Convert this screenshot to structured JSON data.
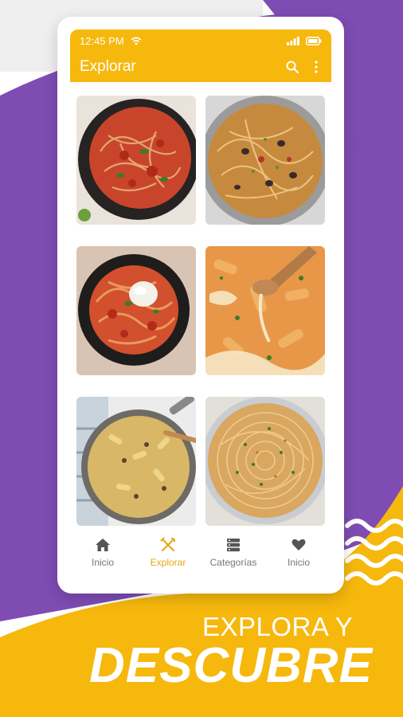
{
  "status_bar": {
    "time": "12:45 PM"
  },
  "app_bar": {
    "title": "Explorar"
  },
  "recipes": [
    {
      "icon": "spaghetti-tomato-basil-image"
    },
    {
      "icon": "spaghetti-olives-pan-image"
    },
    {
      "icon": "bucatini-burrata-image"
    },
    {
      "icon": "baked-ziti-cheese-image"
    },
    {
      "icon": "penne-mushroom-pan-image"
    },
    {
      "icon": "spaghetti-herb-garlic-image"
    }
  ],
  "bottom_nav": {
    "items": [
      {
        "label": "Inicio",
        "icon": "home-icon",
        "active": false
      },
      {
        "label": "Explorar",
        "icon": "fork-knife-icon",
        "active": true
      },
      {
        "label": "Categorías",
        "icon": "categories-icon",
        "active": false
      },
      {
        "label": "Inicio",
        "icon": "heart-icon",
        "active": false
      }
    ]
  },
  "promo": {
    "line1": "EXPLORA Y",
    "line2": "DESCUBRE"
  },
  "colors": {
    "accent": "#f6b80d",
    "purple": "#7e4cb3",
    "active_nav": "#e7a718"
  }
}
